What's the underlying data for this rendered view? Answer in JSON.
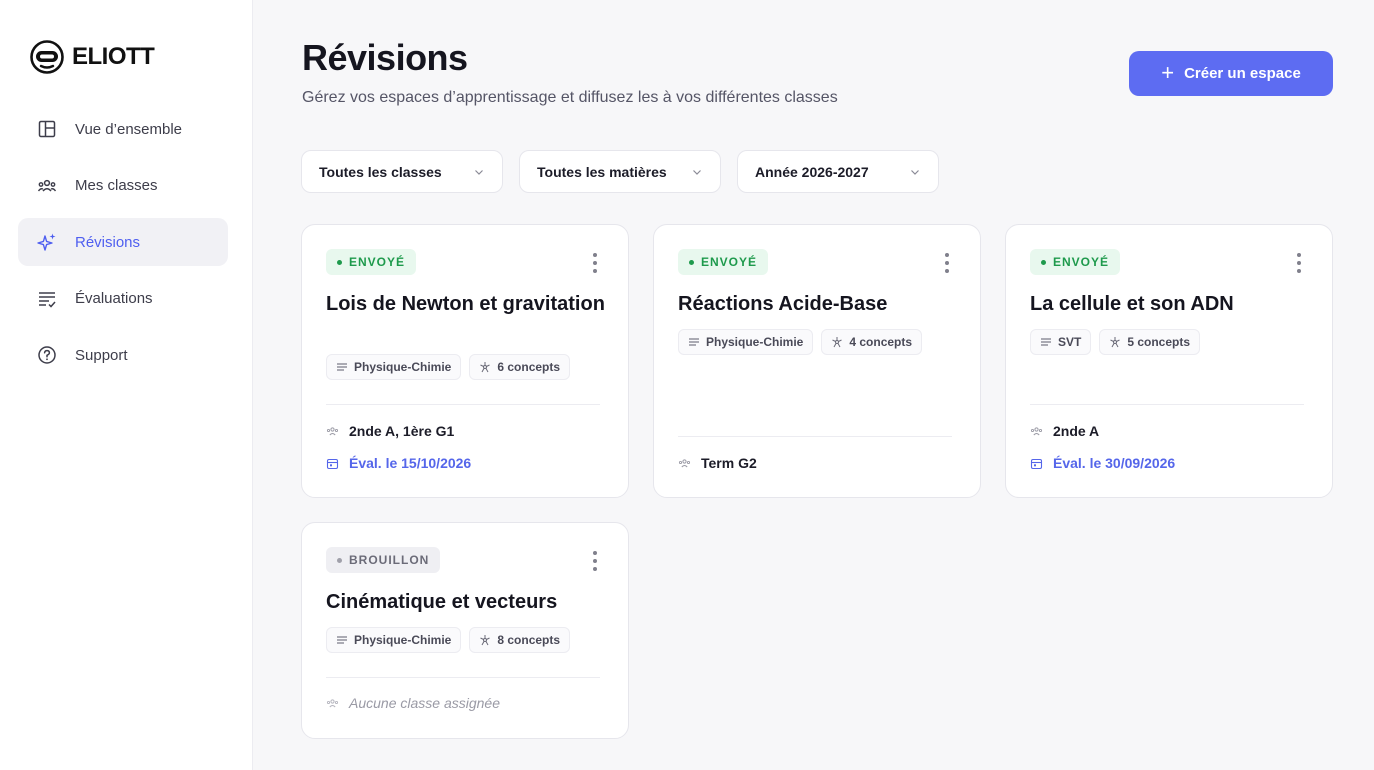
{
  "brand": {
    "name": "ELIOTT"
  },
  "nav": [
    {
      "label": "Vue d’ensemble",
      "icon": "layout-icon",
      "active": false
    },
    {
      "label": "Mes classes",
      "icon": "users-icon",
      "active": false
    },
    {
      "label": "Révisions",
      "icon": "sparkles-icon",
      "active": true
    },
    {
      "label": "Évaluations",
      "icon": "checklist-icon",
      "active": false
    },
    {
      "label": "Support",
      "icon": "help-icon",
      "active": false
    }
  ],
  "header": {
    "title": "Révisions",
    "subtitle": "Gérez vos espaces d’apprentissage et diffusez les à vos différentes classes",
    "create_label": "Créer un espace"
  },
  "filters": [
    {
      "label": "Toutes les classes"
    },
    {
      "label": "Toutes les matières"
    },
    {
      "label": "Année 2026-2027"
    }
  ],
  "colors": {
    "accent": "#5d6cf2",
    "sent": "#1e9a4c",
    "draft": "#6b6b78"
  },
  "cards": [
    {
      "status": "ENVOYÉ",
      "title": "Lois de Newton et gravitation",
      "subject": "Physique-Chimie",
      "concepts": "6 concepts",
      "classes": "2nde A, 1ère G1",
      "eval": "Éval. le 15/10/2026"
    },
    {
      "status": "ENVOYÉ",
      "title": "Réactions Acide-Base",
      "subject": "Physique-Chimie",
      "concepts": "4 concepts",
      "classes": "Term G2",
      "eval": ""
    },
    {
      "status": "ENVOYÉ",
      "title": "La cellule et son ADN",
      "subject": "SVT",
      "concepts": "5 concepts",
      "classes": "2nde A",
      "eval": "Éval. le 30/09/2026"
    },
    {
      "status": "BROUILLON",
      "title": "Cinématique et vecteurs",
      "subject": "Physique-Chimie",
      "concepts": "8 concepts",
      "classes": "Aucune classe assignée",
      "eval": ""
    }
  ]
}
